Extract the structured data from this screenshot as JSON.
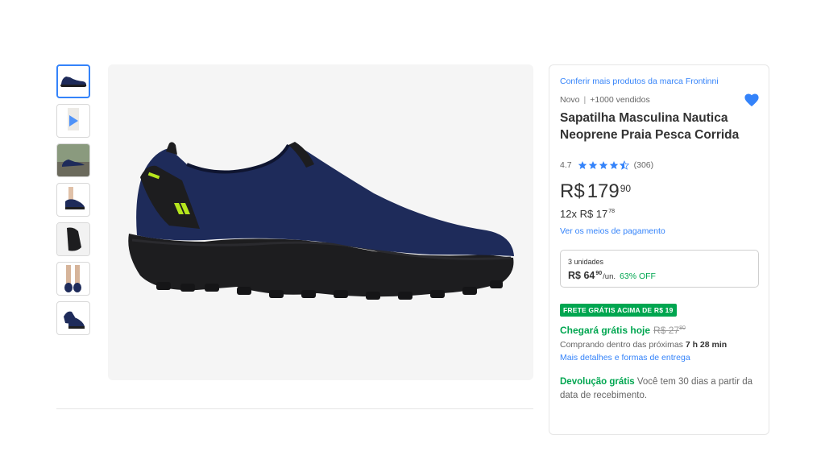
{
  "gallery": {
    "thumbnails": [
      "shoe-side-thumbnail",
      "video-thumbnail",
      "shoe-outdoor-thumbnail",
      "shoe-worn-thumbnail",
      "shoe-top-thumbnail",
      "shoe-legs-thumbnail",
      "shoe-pair-thumbnail"
    ],
    "shoe_colors": {
      "upper": "#1e2b5a",
      "sole": "#1d1d1f",
      "accent": "#b6e61d"
    },
    "main_image": "shoe-main-image"
  },
  "product": {
    "brand_link": "Conferir mais produtos da marca Frontinni",
    "condition": "Novo",
    "separator": "|",
    "sold": "+1000 vendidos",
    "title": "Sapatilha Masculina Nautica Neoprene Praia Pesca Corrida",
    "rating": {
      "value": "4.7",
      "stars": 4.5,
      "count": "(306)"
    },
    "price": {
      "currency": "R$",
      "integer": "179",
      "cents": "90"
    },
    "installments": {
      "text": "12x R$ 17",
      "cents": "78"
    },
    "payment_link": "Ver os meios de pagamento",
    "bulk": {
      "units": "3 unidades",
      "price": "R$ 64",
      "cents": "90",
      "unit": "/un.",
      "off": "63% OFF"
    },
    "shipping_badge": "FRETE GRÁTIS ACIMA DE R$ 19",
    "arrives": {
      "text": "Chegará grátis hoje",
      "old_price": "R$ 27",
      "old_cents": "80"
    },
    "buy_within": {
      "text": "Comprando dentro das próximas",
      "time": "7 h 28 min"
    },
    "delivery_link": "Mais detalhes e formas de entrega",
    "returns": {
      "title": "Devolução grátis",
      "text": "Você tem 30 dias a partir da data de recebimento."
    }
  },
  "colors": {
    "link": "#3483fa",
    "green": "#00a650",
    "favorite": "#3483fa"
  },
  "icons": {
    "favorite": "heart-icon",
    "star": "star-icon",
    "video": "play-icon"
  }
}
